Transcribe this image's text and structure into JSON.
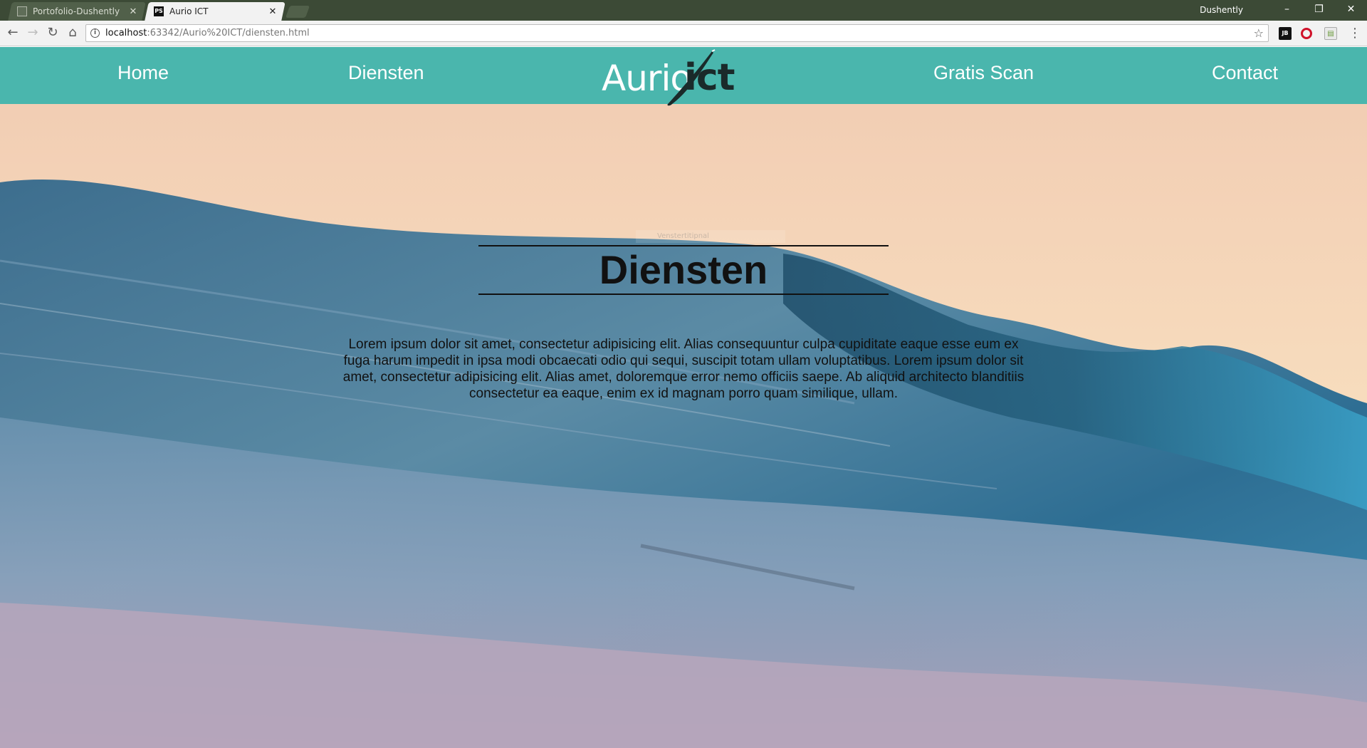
{
  "browser": {
    "tabs": [
      {
        "title": "Portofolio-Dushently",
        "active": false
      },
      {
        "title": "Aurio ICT",
        "active": true
      }
    ],
    "profile_name": "Dushently",
    "window_controls": {
      "minimize": "–",
      "maximize": "❐",
      "close": "✕"
    },
    "url_host": "localhost",
    "url_rest": ":63342/Aurio%20ICT/diensten.html",
    "icons": {
      "back": "back-arrow-icon",
      "forward": "forward-arrow-icon",
      "reload": "reload-icon",
      "home": "home-icon",
      "info": "info-icon",
      "bookmark": "star-icon",
      "menu": "menu-icon"
    }
  },
  "site": {
    "nav": {
      "home": "Home",
      "diensten": "Diensten",
      "scan": "Gratis Scan",
      "contact": "Contact"
    },
    "logo": {
      "part1": "Aurio",
      "part2": "ict"
    },
    "colors": {
      "header": "#4ab6ad",
      "text": "#111111"
    }
  },
  "main": {
    "heading": "Diensten",
    "overlay_label": "Venstertitipnal",
    "body": "Lorem ipsum dolor sit amet, consectetur adipisicing elit. Alias consequuntur culpa cupiditate eaque esse eum ex fuga harum impedit in ipsa modi obcaecati odio qui sequi, suscipit totam ullam voluptatibus. Lorem ipsum dolor sit amet, consectetur adipisicing elit. Alias amet, doloremque error nemo officiis saepe. Ab aliquid architecto blanditiis consectetur ea eaque, enim ex id magnam porro quam similique, ullam."
  }
}
